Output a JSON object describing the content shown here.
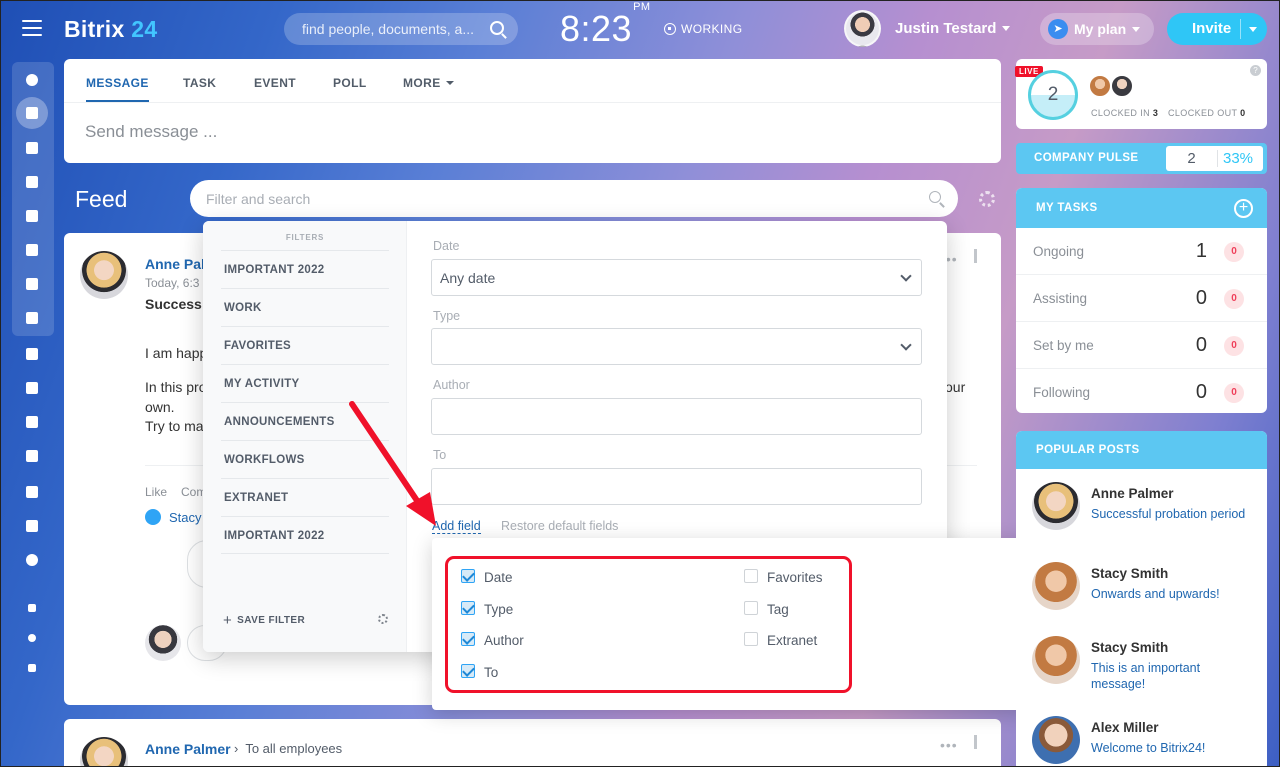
{
  "header": {
    "logo_main": "Bitrix",
    "logo_num": "24",
    "search_placeholder": "find people, documents, a...",
    "time": "8:23",
    "ampm": "PM",
    "status": "WORKING",
    "user_name": "Justin Testard",
    "plan_label": "My plan",
    "invite_label": "Invite"
  },
  "composer": {
    "tabs": [
      "MESSAGE",
      "TASK",
      "EVENT",
      "POLL",
      "MORE"
    ],
    "placeholder": "Send message ..."
  },
  "feed": {
    "title": "Feed",
    "filter_placeholder": "Filter and search"
  },
  "post": {
    "author": "Anne Pal",
    "date": "Today, 6:3",
    "title": "Success",
    "line1": "I am happ",
    "line2a": "In this pro",
    "line2b": "own.",
    "line2c": "our",
    "line3": "Try to ma",
    "like": "Like",
    "comment": "Com",
    "liker": "Stacy"
  },
  "post2": {
    "author": "Anne Palmer",
    "to": "To all employees"
  },
  "filters": {
    "header": "FILTERS",
    "presets": [
      "IMPORTANT 2022",
      "WORK",
      "FAVORITES",
      "MY ACTIVITY",
      "ANNOUNCEMENTS",
      "WORKFLOWS",
      "EXTRANET",
      "IMPORTANT 2022"
    ],
    "save_label": "SAVE FILTER",
    "fields": {
      "date_label": "Date",
      "date_value": "Any date",
      "type_label": "Type",
      "author_label": "Author",
      "to_label": "To"
    },
    "add_field": "Add field",
    "restore": "Restore default fields"
  },
  "add_field_popup": {
    "left": [
      {
        "label": "Date",
        "checked": true
      },
      {
        "label": "Type",
        "checked": true
      },
      {
        "label": "Author",
        "checked": true
      },
      {
        "label": "To",
        "checked": true
      }
    ],
    "right": [
      {
        "label": "Favorites",
        "checked": false
      },
      {
        "label": "Tag",
        "checked": false
      },
      {
        "label": "Extranet",
        "checked": false
      }
    ]
  },
  "timeman": {
    "live": "LIVE",
    "count": "2",
    "clocked_in_label": "CLOCKED IN",
    "clocked_in_value": "3",
    "clocked_out_label": "CLOCKED OUT",
    "clocked_out_value": "0",
    "help": "?"
  },
  "pulse": {
    "label": "COMPANY PULSE",
    "value": "2",
    "percent": "33%"
  },
  "tasks": {
    "title": "MY TASKS",
    "rows": [
      {
        "name": "Ongoing",
        "count": "1",
        "badge": "0"
      },
      {
        "name": "Assisting",
        "count": "0",
        "badge": "0"
      },
      {
        "name": "Set by me",
        "count": "0",
        "badge": "0"
      },
      {
        "name": "Following",
        "count": "0",
        "badge": "0"
      }
    ]
  },
  "popular": {
    "title": "POPULAR POSTS",
    "items": [
      {
        "name": "Anne Palmer",
        "text": "Successful probation period"
      },
      {
        "name": "Stacy Smith",
        "text": "Onwards and upwards!"
      },
      {
        "name": "Stacy Smith",
        "text": "This is an important message!"
      },
      {
        "name": "Alex Miller",
        "text": "Welcome to Bitrix24!"
      }
    ]
  },
  "colors": {
    "accent": "#2fc6f6",
    "link": "#2067b0",
    "annotation": "#f0112a"
  }
}
